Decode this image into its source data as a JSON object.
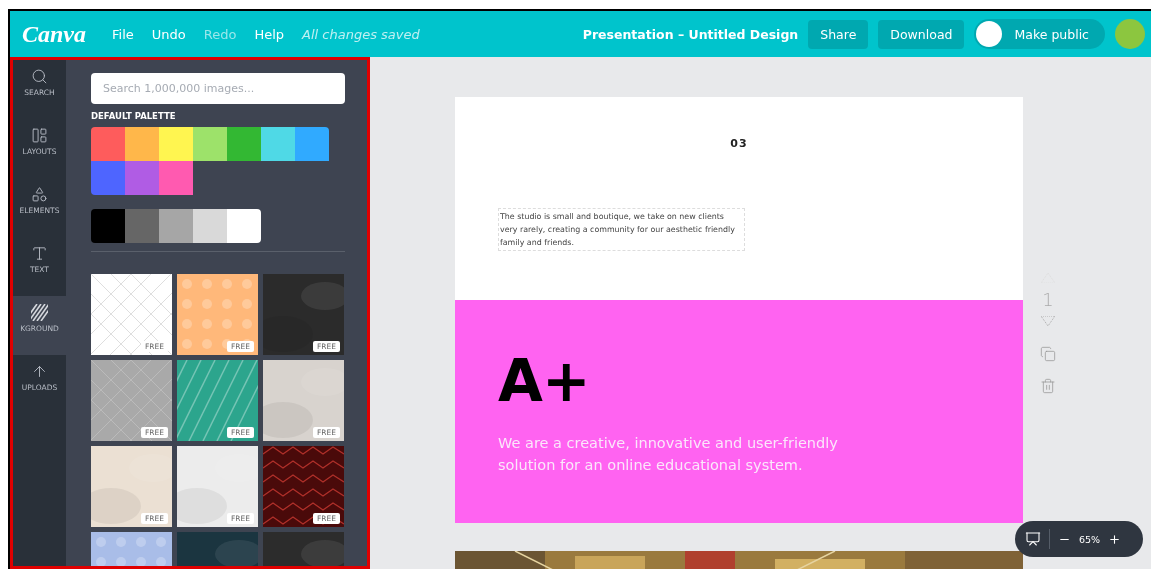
{
  "topbar": {
    "logo": "Canva",
    "menu": [
      {
        "label": "File",
        "disabled": false
      },
      {
        "label": "Undo",
        "disabled": false
      },
      {
        "label": "Redo",
        "disabled": true
      },
      {
        "label": "Help",
        "disabled": false
      }
    ],
    "save_status": "All changes saved",
    "document_title": "Presentation – Untitled Design",
    "buttons": [
      "Share",
      "Download"
    ],
    "public_toggle": {
      "label": "Make public",
      "on": false
    }
  },
  "sidebar": {
    "tabs": [
      {
        "kind": "search",
        "label": "SEARCH",
        "selected": false
      },
      {
        "kind": "layouts",
        "label": "LAYOUTS",
        "selected": false
      },
      {
        "kind": "elements",
        "label": "ELEMENTS",
        "selected": false
      },
      {
        "kind": "text",
        "label": "TEXT",
        "selected": false
      },
      {
        "kind": "background",
        "label": "KGROUND",
        "selected": true
      },
      {
        "kind": "uploads",
        "label": "UPLOADS",
        "selected": false
      }
    ],
    "search": {
      "placeholder": "Search 1,000,000 images..."
    },
    "palette": {
      "title": "DEFAULT PALETTE",
      "colors": [
        {
          "color": "#fe5c5c"
        },
        {
          "color": "#ffb74a"
        },
        {
          "color": "#fff550"
        },
        {
          "color": "#9de26a"
        },
        {
          "color": "#33b833"
        },
        {
          "color": "#4fd9e6"
        },
        {
          "color": "#30aaff"
        },
        {
          "color": "#4e65ff"
        },
        {
          "color": "#b05ce4"
        },
        {
          "color": "#ff5ab0"
        }
      ],
      "grays": [
        {
          "color": "#000000"
        },
        {
          "color": "#666666"
        },
        {
          "color": "#a6a6a6"
        },
        {
          "color": "#d9d9d9"
        },
        {
          "color": "#ffffff"
        }
      ]
    },
    "backgrounds": [
      {
        "kind": "diamond",
        "color": "#ffffff",
        "badge": "FREE"
      },
      {
        "kind": "dots",
        "color": "#ffb87a",
        "badge": "FREE"
      },
      {
        "kind": "texture",
        "color": "#2b2b2b",
        "badge": "FREE"
      },
      {
        "kind": "diamond",
        "color": "#a9a9a9",
        "badge": "FREE"
      },
      {
        "kind": "stripes",
        "color": "#2ca58d",
        "badge": "FREE"
      },
      {
        "kind": "texture",
        "color": "#d8d3ce",
        "badge": "FREE"
      },
      {
        "kind": "texture",
        "color": "#ebe0d3",
        "badge": "FREE"
      },
      {
        "kind": "texture",
        "color": "#ececec",
        "badge": "FREE"
      },
      {
        "kind": "chevron",
        "color": "#4a0a0a",
        "badge": "FREE"
      },
      {
        "kind": "dots",
        "color": "#a9bde8"
      },
      {
        "kind": "texture",
        "color": "#1b3540"
      },
      {
        "kind": "texture",
        "color": "#2c2c2c"
      }
    ]
  },
  "canvas": {
    "page": {
      "number": "03",
      "body": "The studio is small and boutique, we take on new clients very rarely, creating a community for our aesthetic friendly family and friends.",
      "headline": "A+",
      "tagline": "We are a creative, innovative and user-friendly solution for an online educational system."
    },
    "page_tools": {
      "page_number": "1"
    },
    "zoom": {
      "level_text": "65%"
    }
  }
}
